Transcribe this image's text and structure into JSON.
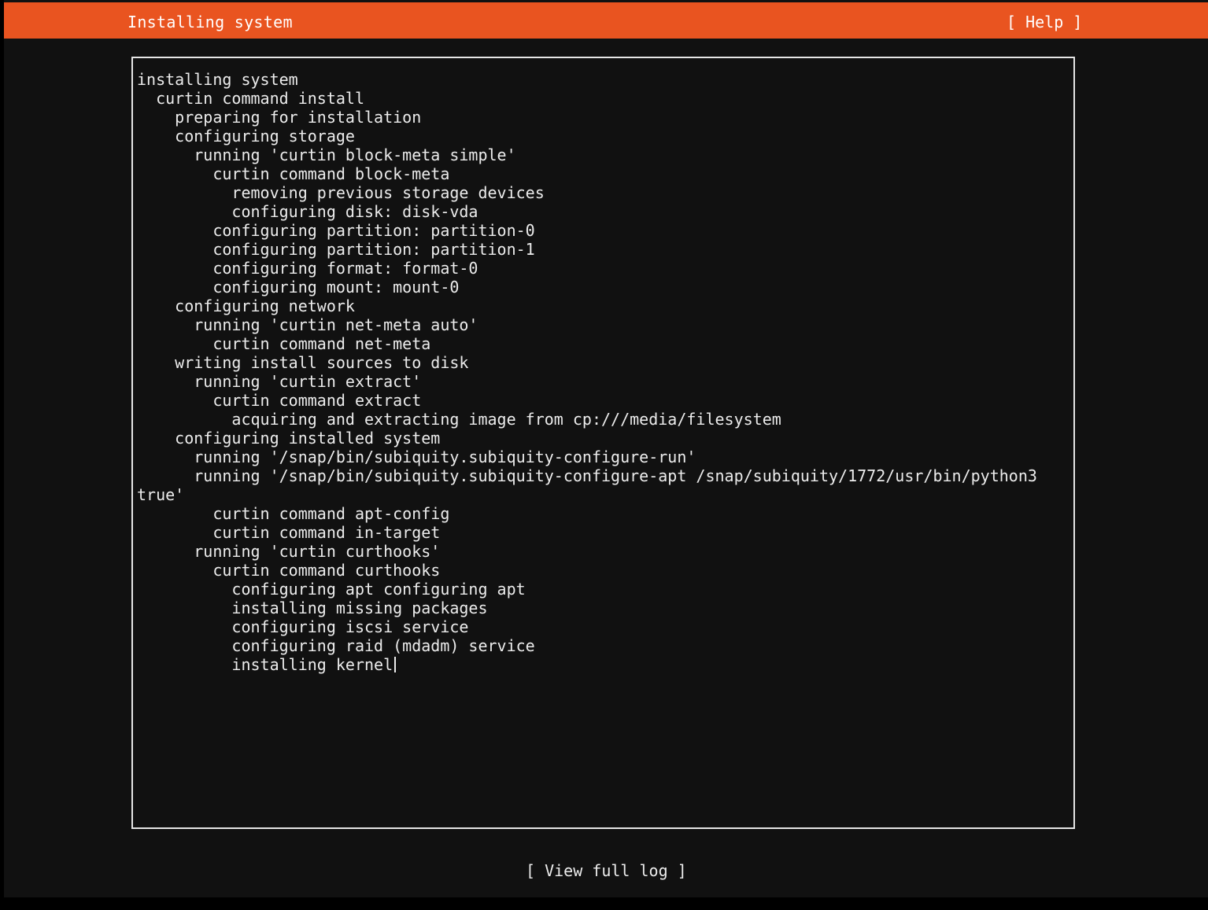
{
  "header": {
    "title": "Installing system",
    "help_label": "[ Help ]"
  },
  "colors": {
    "header_background": "#e95420",
    "screen_background": "#111111",
    "text": "#ececec"
  },
  "log": {
    "lines": [
      "installing system",
      "  curtin command install",
      "    preparing for installation",
      "    configuring storage",
      "      running 'curtin block-meta simple'",
      "        curtin command block-meta",
      "          removing previous storage devices",
      "          configuring disk: disk-vda",
      "        configuring partition: partition-0",
      "        configuring partition: partition-1",
      "        configuring format: format-0",
      "        configuring mount: mount-0",
      "    configuring network",
      "      running 'curtin net-meta auto'",
      "        curtin command net-meta",
      "    writing install sources to disk",
      "      running 'curtin extract'",
      "        curtin command extract",
      "          acquiring and extracting image from cp:///media/filesystem",
      "    configuring installed system",
      "      running '/snap/bin/subiquity.subiquity-configure-run'",
      "      running '/snap/bin/subiquity.subiquity-configure-apt /snap/subiquity/1772/usr/bin/python3",
      "true'",
      "        curtin command apt-config",
      "        curtin command in-target",
      "      running 'curtin curthooks'",
      "        curtin command curthooks",
      "          configuring apt configuring apt",
      "          installing missing packages",
      "          configuring iscsi service",
      "          configuring raid (mdadm) service",
      "          installing kernel"
    ]
  },
  "footer": {
    "view_log_label": "[ View full log ]"
  }
}
